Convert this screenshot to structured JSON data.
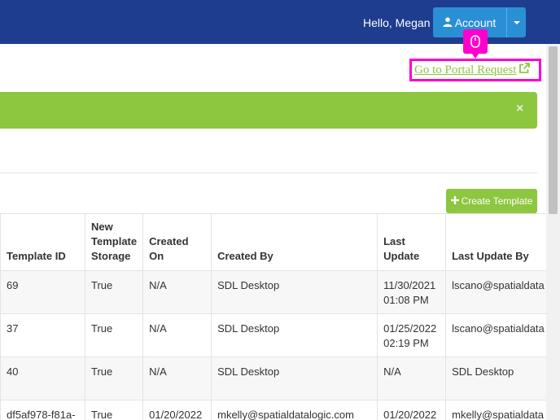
{
  "header": {
    "greeting": "Hello, Megan",
    "account_label": "Account"
  },
  "portal_link": {
    "label": "Go to Portal Request"
  },
  "alert": {
    "close": "×"
  },
  "toolbar": {
    "create_template_label": "Create Template"
  },
  "table": {
    "columns": [
      "Template ID",
      "New Template Storage",
      "Created On",
      "Created By",
      "Last Update",
      "Last Update By"
    ],
    "rows": [
      [
        "69",
        "True",
        "N/A",
        "SDL Desktop",
        "11/30/2021 01:08 PM",
        "lscano@spatialdata"
      ],
      [
        "37",
        "True",
        "N/A",
        "SDL Desktop",
        "01/25/2022 02:19 PM",
        "lscano@spatialdata"
      ],
      [
        "40",
        "True",
        "N/A",
        "SDL Desktop",
        "N/A",
        "SDL Desktop"
      ],
      [
        "df5af978-f81a-",
        "True",
        "01/20/2022",
        "mkelly@spatialdatalogic.com",
        "01/20/2022",
        "mkelly@spatialdata"
      ]
    ]
  },
  "colors": {
    "topbar": "#1e3d8f",
    "account_button": "#2b8fd6",
    "accent_green": "#8dc63f",
    "highlight": "#ff00cc"
  }
}
